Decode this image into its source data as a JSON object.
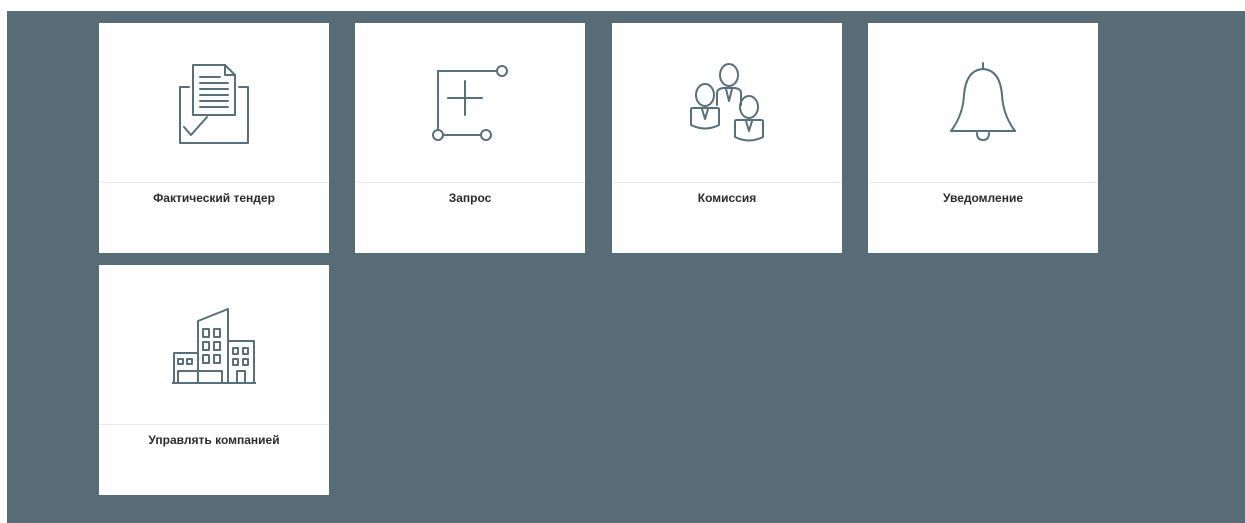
{
  "colors": {
    "background": "#576c76",
    "tile": "#ffffff",
    "icon_stroke": "#57707b",
    "label": "#2b2b2b"
  },
  "tiles": [
    {
      "label": "Фактический тендер",
      "icon": "tender-document-icon"
    },
    {
      "label": "Запрос",
      "icon": "request-flow-icon"
    },
    {
      "label": "Комиссия",
      "icon": "commission-people-icon"
    },
    {
      "label": "Уведомление",
      "icon": "bell-icon"
    },
    {
      "label": "Управлять компанией",
      "icon": "company-buildings-icon"
    }
  ]
}
